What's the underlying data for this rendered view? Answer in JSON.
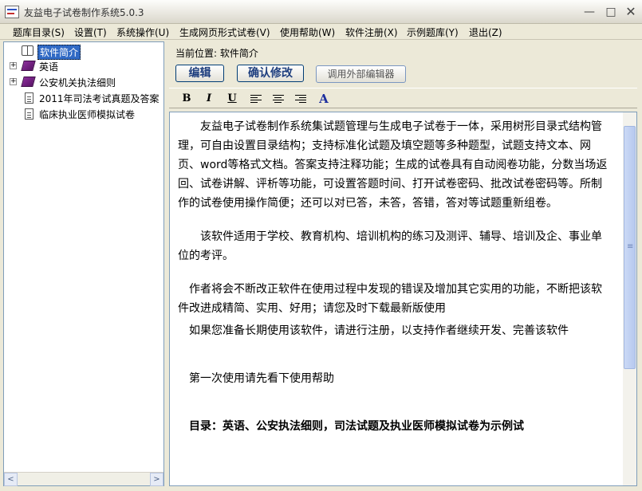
{
  "window": {
    "title": "友益电子试卷制作系统5.0.3",
    "minimize": "—",
    "maximize": "□",
    "close": "✕"
  },
  "menu": [
    "题库目录(S)",
    "设置(T)",
    "系统操作(U)",
    "生成网页形式试卷(V)",
    "使用帮助(W)",
    "软件注册(X)",
    "示例题库(Y)",
    "退出(Z)"
  ],
  "tree": {
    "items": [
      {
        "label": "软件简介",
        "icon": "book-open-icon",
        "selected": true
      },
      {
        "label": "英语",
        "icon": "book-icon",
        "expander": "+"
      },
      {
        "label": "公安机关执法细则",
        "icon": "book-icon",
        "expander": "+"
      },
      {
        "label": "2011年司法考试真题及答案",
        "icon": "document-icon"
      },
      {
        "label": "临床执业医师模拟试卷",
        "icon": "document-icon"
      }
    ],
    "scroll_left": "<",
    "scroll_right": ">"
  },
  "location": {
    "text": "当前位置: 软件简介"
  },
  "buttons": {
    "edit": "编辑",
    "confirm": "确认修改",
    "external_editor": "调用外部编辑器"
  },
  "format_bar": {
    "bold": "B",
    "italic": "I",
    "underline": "U",
    "font_color": "A"
  },
  "editor": {
    "paragraphs": [
      "友益电子试卷制作系统集试题管理与生成电子试卷于一体，采用树形目录式结构管理，可自由设置目录结构；支持标准化试题及填空题等多种题型，试题支持文本、网页、word等格式文档。答案支持注释功能；生成的试卷具有自动阅卷功能，分数当场返回、试卷讲解、评析等功能，可设置答题时间、打开试卷密码、批改试卷密码等。所制作的试卷使用操作简便；还可以对已答，未答，答错，答对等试题重新组卷。",
      "该软件适用于学校、教育机构、培训机构的练习及测评、辅导、培训及企、事业单位的考评。",
      "作者将会不断改正软件在使用过程中发现的错误及增加其它实用的功能，不断把该软件改进成精简、实用、好用；请您及时下载最新版使用",
      "如果您准备长期使用该软件，请进行注册，以支持作者继续开发、完善该软件",
      "第一次使用请先看下使用帮助",
      "目录：英语、公安执法细则，司法试题及执业医师模拟试卷为示例试"
    ]
  },
  "colors": {
    "selection": "#316AC5",
    "window_bg": "#ECE9D8",
    "button_text": "#1F3F7F"
  }
}
